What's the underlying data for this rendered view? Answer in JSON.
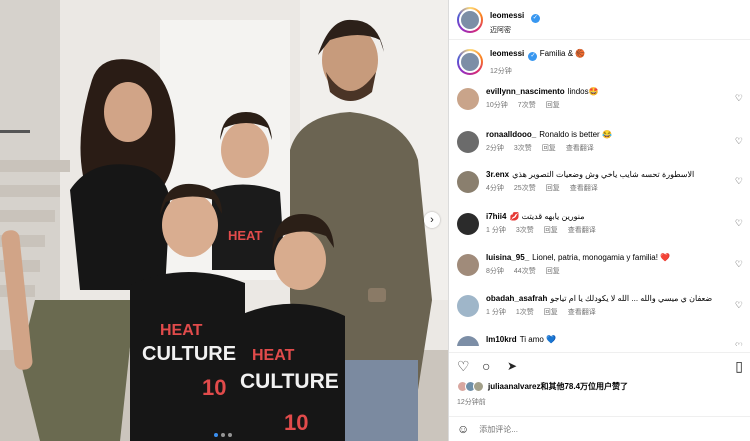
{
  "post": {
    "author": "leomessi",
    "location": "迈阿密",
    "caption_text": "Familia & 🏀",
    "caption_time": "12分钟",
    "photo_jersey_text": "HEAT",
    "photo_jersey_text2": "CULTURE",
    "photo_jersey_number": "10",
    "photo_dots": 3,
    "photo_active_dot": 0
  },
  "icons": {
    "verified": "verified-badge",
    "next": "chevron-right-icon",
    "like": "heart-outline-icon",
    "comment": "speech-bubble-icon",
    "share": "paper-plane-icon",
    "save": "bookmark-icon",
    "emoji": "smiley-icon"
  },
  "glyphs": {
    "verified": "✓",
    "next": "›",
    "heart": "♡",
    "comment": "○",
    "share": "➤",
    "save": "▯",
    "emoji": "☺"
  },
  "comments": [
    {
      "user": "evillynn_nascimento",
      "text": "lindos🤩",
      "time": "10分钟",
      "likes": "7次赞",
      "reply": "回复",
      "view": "",
      "avatar_color": "#c9a48a"
    },
    {
      "user": "ronaalldooo_",
      "text": "Ronaldo is better 😂",
      "time": "2分钟",
      "likes": "3次赞",
      "reply": "回复",
      "view": "查看翻译",
      "avatar_color": "#6b6b6b"
    },
    {
      "user": "3r.enx",
      "text": "الاسطورة تحسه شايب ياخي وش وضعيات التصوير هذي",
      "time": "4分钟",
      "likes": "25次赞",
      "reply": "回复",
      "view": "查看翻译",
      "avatar_color": "#8a7f6e"
    },
    {
      "user": "i7hii4",
      "text": "💋 منورين يابهه قديتت",
      "time": "1 分钟",
      "likes": "3次赞",
      "reply": "回复",
      "view": "查看翻译",
      "avatar_color": "#2b2b2b"
    },
    {
      "user": "luisina_95_",
      "text": "Lionel, patria, monogamia y familia! ❤️",
      "time": "8分钟",
      "likes": "44次赞",
      "reply": "回复",
      "view": "",
      "avatar_color": "#a08b7a"
    },
    {
      "user": "obadah_asafrah",
      "text": "ضعفان ي ميسي والله ... الله لا يكودلك يا ام تياجو",
      "time": "1 分钟",
      "likes": "1次赞",
      "reply": "回复",
      "view": "查看翻译",
      "avatar_color": "#9fb6c9"
    },
    {
      "user": "lm10krd",
      "text": "Ti amo 💙",
      "time": "",
      "likes": "",
      "reply": "",
      "view": "",
      "avatar_color": "#7c8ea6"
    }
  ],
  "likes": {
    "text": "juliaanalvarez和其他78.4万位用户赞了",
    "time": "12分钟前",
    "avatar_colors": [
      "#d9a7a0",
      "#6f8fa8",
      "#a3a08a"
    ]
  },
  "add_comment": {
    "placeholder": "添加评论..."
  }
}
